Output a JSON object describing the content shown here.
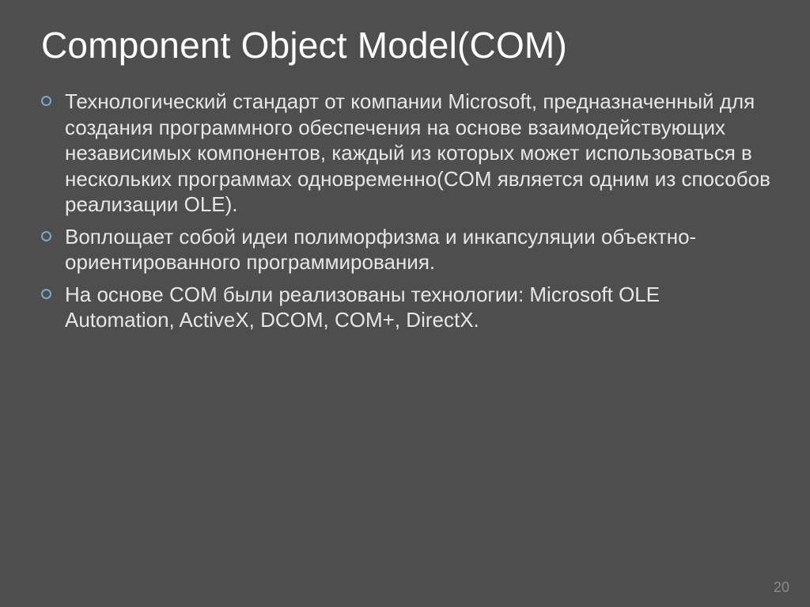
{
  "title": "Component Object Model(COM)",
  "bullets": [
    "Технологический стандарт от компании Microsoft, предназначенный для создания программного обеспечения на основе взаимодействующих независимых компонентов, каждый из которых может использоваться в нескольких программах одновременно(COM является одним из способов реализации OLE).",
    "Воплощает собой идеи полиморфизма и инкапсуляции объектно-ориентированного программирования.",
    "На основе COM были реализованы технологии: Microsoft OLE Automation, ActiveX, DCOM, COM+, DirectX."
  ],
  "page_number": "20",
  "colors": {
    "background": "#4e4e4e",
    "bullet_ring": "#7aa8c9",
    "title": "#ffffff",
    "text": "#e6e6e6",
    "page_num": "#8a8a8a"
  }
}
